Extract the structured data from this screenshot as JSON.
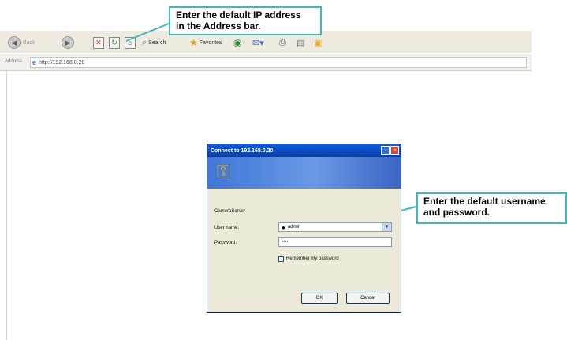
{
  "toolbar": {
    "back_label": "Back",
    "search_label": "Search",
    "favorites_label": "Favorites"
  },
  "address_bar": {
    "label": "Address",
    "url": "http://192.168.0.20"
  },
  "callouts": {
    "address": [
      "Enter the default IP address",
      "in the Address bar."
    ],
    "credentials": [
      "Enter the default username",
      "and password."
    ]
  },
  "dialog": {
    "title": "Connect to 192.168.0.20",
    "realm": "CameraServer",
    "user_label": "User name:",
    "user_value": "admin",
    "password_label": "Password:",
    "password_value": "•••••",
    "remember_label": "Remember my password",
    "ok_label": "OK",
    "cancel_label": "Cancel"
  },
  "colors": {
    "callout_border": "#3fb8b8",
    "title_bar": "#0a5bd8"
  }
}
